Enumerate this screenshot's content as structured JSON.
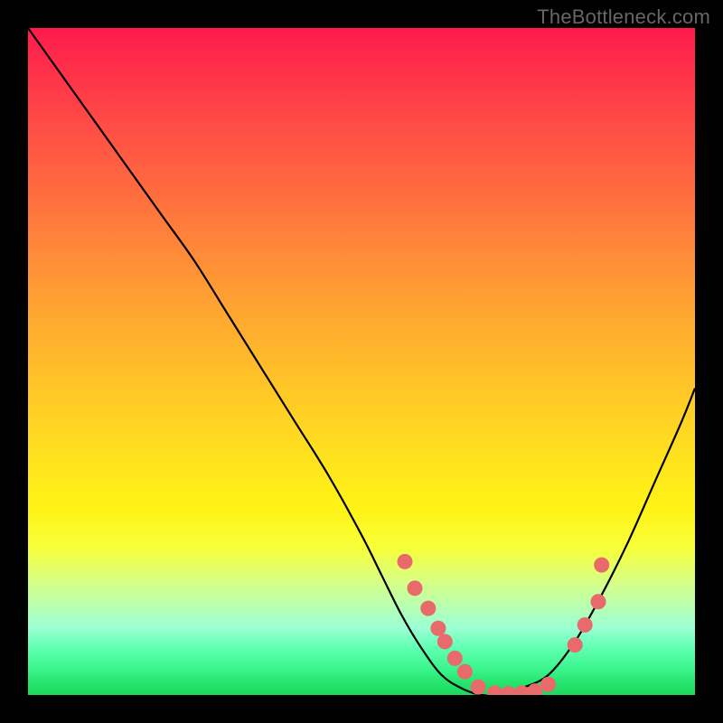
{
  "watermark": "TheBottleneck.com",
  "chart_data": {
    "type": "line",
    "title": "",
    "xlabel": "",
    "ylabel": "",
    "xlim": [
      0,
      100
    ],
    "ylim": [
      0,
      100
    ],
    "grid": false,
    "legend": false,
    "series": [
      {
        "name": "bottleneck-curve",
        "x": [
          0,
          5,
          10,
          15,
          20,
          25,
          30,
          35,
          40,
          45,
          50,
          53,
          56,
          59,
          62,
          65,
          68,
          71,
          74,
          78,
          82,
          86,
          90,
          94,
          98,
          100
        ],
        "y": [
          100,
          93,
          86,
          79,
          72,
          65,
          57,
          49,
          41,
          33,
          24,
          18,
          12,
          7,
          3,
          1,
          0,
          0,
          1,
          3,
          8,
          15,
          23,
          32,
          41,
          46
        ]
      }
    ],
    "markers": [
      {
        "x": 56.5,
        "y": 20.0
      },
      {
        "x": 58.0,
        "y": 16.0
      },
      {
        "x": 60.0,
        "y": 13.0
      },
      {
        "x": 61.5,
        "y": 10.0
      },
      {
        "x": 62.5,
        "y": 8.0
      },
      {
        "x": 64.0,
        "y": 5.5
      },
      {
        "x": 65.5,
        "y": 3.5
      },
      {
        "x": 67.5,
        "y": 1.2
      },
      {
        "x": 70.0,
        "y": 0.3
      },
      {
        "x": 72.0,
        "y": 0.2
      },
      {
        "x": 74.0,
        "y": 0.3
      },
      {
        "x": 76.0,
        "y": 0.6
      },
      {
        "x": 78.0,
        "y": 1.6
      },
      {
        "x": 82.0,
        "y": 7.5
      },
      {
        "x": 83.5,
        "y": 10.5
      },
      {
        "x": 85.5,
        "y": 14.0
      },
      {
        "x": 86.0,
        "y": 19.5
      }
    ],
    "colors": {
      "curve": "#000000",
      "marker_fill": "#e86a6a",
      "marker_stroke": "#e86a6a"
    }
  }
}
